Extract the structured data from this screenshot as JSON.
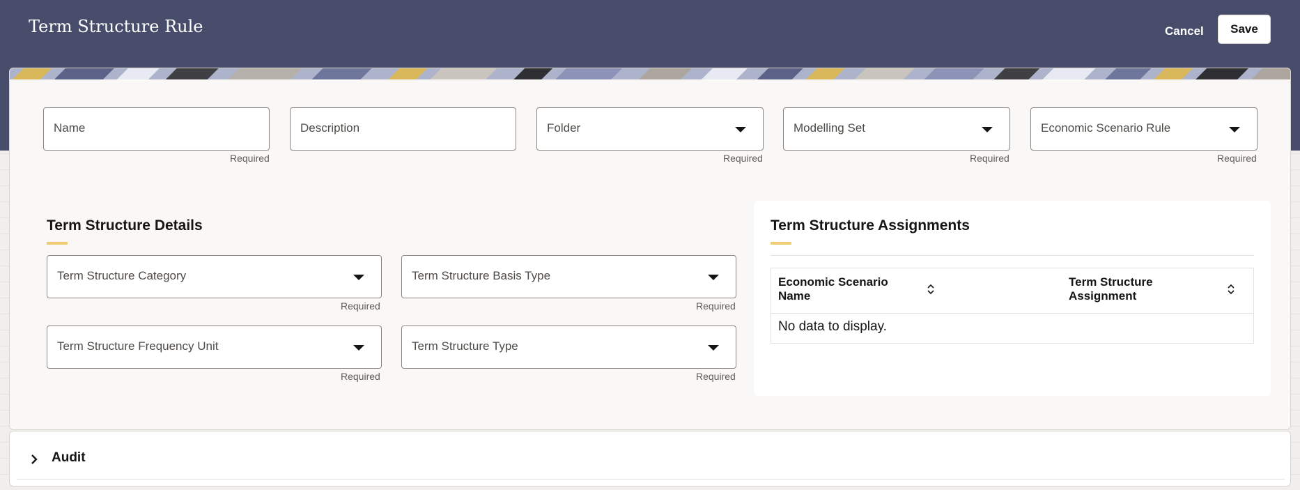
{
  "header": {
    "title": "Term Structure Rule",
    "cancel_label": "Cancel",
    "save_label": "Save"
  },
  "top_fields": [
    {
      "label": "Name",
      "required": "Required",
      "dropdown": false
    },
    {
      "label": "Description",
      "required": "",
      "dropdown": false
    },
    {
      "label": "Folder",
      "required": "Required",
      "dropdown": true
    },
    {
      "label": "Modelling Set",
      "required": "Required",
      "dropdown": true
    },
    {
      "label": "Economic Scenario Rule",
      "required": "Required",
      "dropdown": true
    }
  ],
  "details": {
    "title": "Term Structure Details",
    "fields": [
      {
        "label": "Term Structure Category",
        "required": "Required"
      },
      {
        "label": "Term Structure Basis Type",
        "required": "Required"
      },
      {
        "label": "Term Structure Frequency Unit",
        "required": "Required"
      },
      {
        "label": "Term Structure Type",
        "required": "Required"
      }
    ]
  },
  "assignments": {
    "title": "Term Structure Assignments",
    "columns": [
      "Economic Scenario Name",
      "Term Structure Assignment"
    ],
    "empty_text": "No data to display."
  },
  "audit": {
    "label": "Audit"
  },
  "colors": {
    "header_bg": "#474c6b",
    "accent": "#f0cc71",
    "card_bg": "#f9f8f6"
  }
}
